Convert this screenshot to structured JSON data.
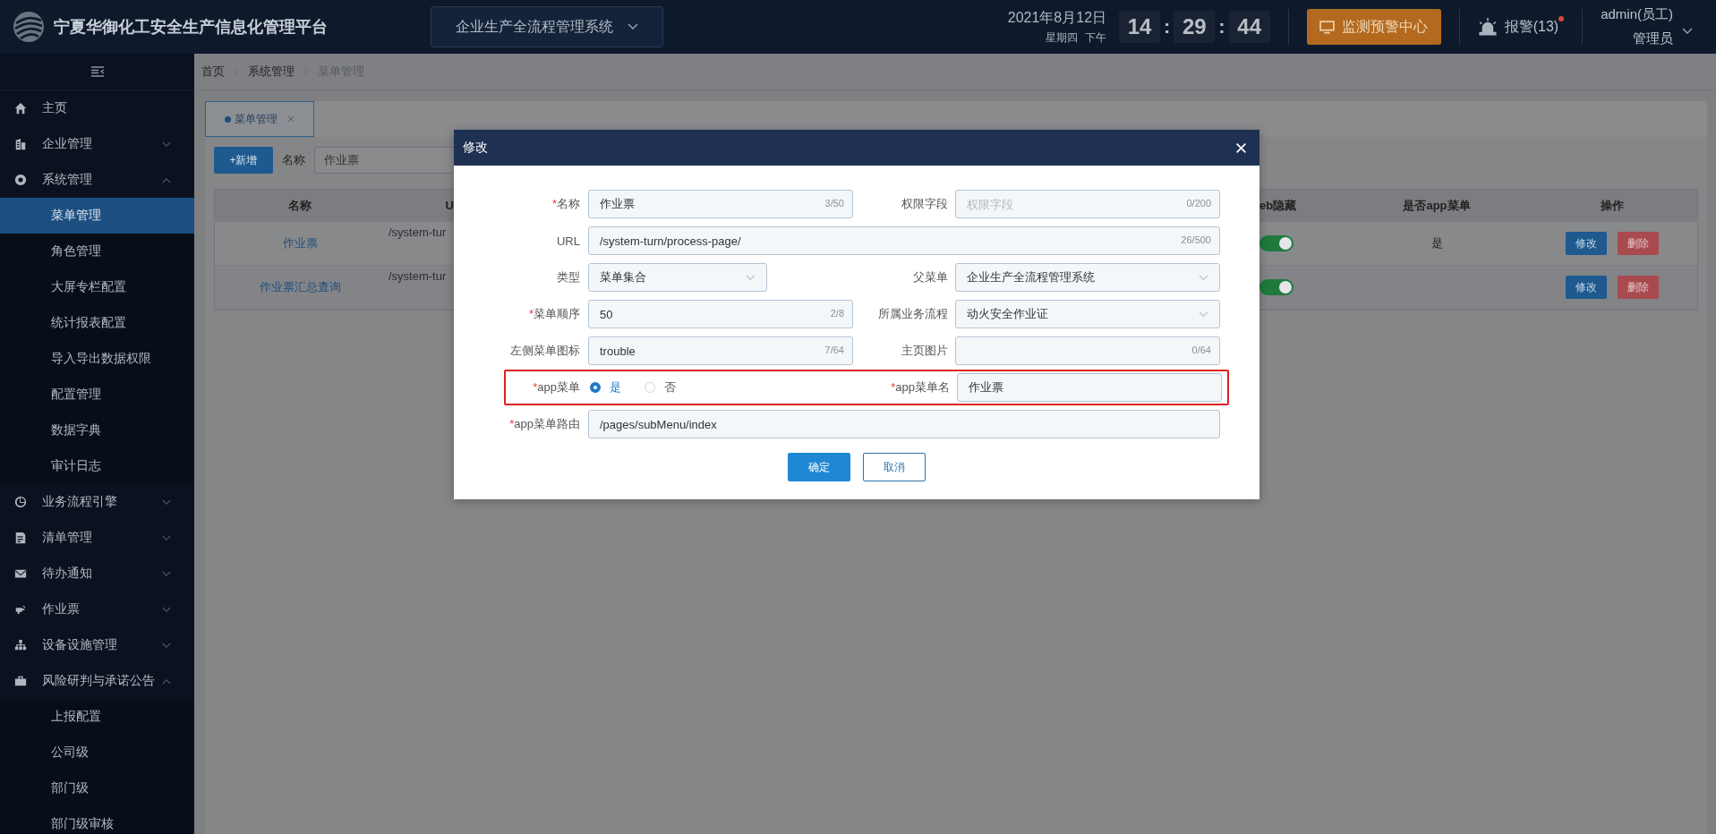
{
  "header": {
    "title": "宁夏华御化工安全生产信息化管理平台",
    "system_select": "企业生产全流程管理系统",
    "date": "2021年8月12日",
    "weekday": "星期四",
    "period": "下午",
    "clock": [
      "14",
      "29",
      "44"
    ],
    "clock_separator": ":",
    "monitor_button": "监测预警中心",
    "alarm": "报警(13)",
    "alarm_unread": true,
    "user": "admin(员工)",
    "role": "管理员"
  },
  "sidebar": {
    "items": [
      {
        "label": "主页",
        "kind": "link",
        "selected": false
      },
      {
        "label": "企业管理",
        "kind": "group",
        "selected": false,
        "expanded": false
      },
      {
        "label": "系统管理",
        "kind": "group",
        "selected": false,
        "expanded": true,
        "children": [
          {
            "label": "菜单管理",
            "selected": true
          },
          {
            "label": "角色管理",
            "selected": false
          },
          {
            "label": "大屏专栏配置",
            "selected": false
          },
          {
            "label": "统计报表配置",
            "selected": false
          },
          {
            "label": "导入导出数据权限",
            "selected": false
          },
          {
            "label": "配置管理",
            "selected": false
          },
          {
            "label": "数据字典",
            "selected": false
          },
          {
            "label": "审计日志",
            "selected": false
          }
        ]
      },
      {
        "label": "业务流程引擎",
        "kind": "group",
        "selected": false,
        "expanded": false
      },
      {
        "label": "清单管理",
        "kind": "group",
        "selected": false,
        "expanded": false
      },
      {
        "label": "待办通知",
        "kind": "group",
        "selected": false,
        "expanded": false
      },
      {
        "label": "作业票",
        "kind": "group",
        "selected": false,
        "expanded": false
      },
      {
        "label": "设备设施管理",
        "kind": "group",
        "selected": false,
        "expanded": false
      },
      {
        "label": "风险研判与承诺公告",
        "kind": "group",
        "selected": false,
        "expanded": true,
        "children": [
          {
            "label": "上报配置",
            "selected": false
          },
          {
            "label": "公司级",
            "selected": false
          },
          {
            "label": "部门级",
            "selected": false
          },
          {
            "label": "部门级审核",
            "selected": false
          }
        ]
      }
    ]
  },
  "breadcrumb": [
    "首页",
    "系统管理",
    "菜单管理"
  ],
  "tabs": [
    {
      "label": "菜单管理",
      "selected": true
    }
  ],
  "toolbar": {
    "add_button": "+新增",
    "name_label": "名称",
    "name_value": "作业票"
  },
  "table": {
    "columns": [
      "名称",
      "U",
      "eb隐藏",
      "是否app菜单",
      "操作"
    ],
    "rows": [
      {
        "name": "作业票",
        "url": "/system-tur",
        "web_hidden": true,
        "app_menu": "是",
        "actions": [
          "修改",
          "删除"
        ]
      },
      {
        "name": "作业票汇总查询",
        "url": "/system-tur",
        "web_hidden": true,
        "actions": [
          "修改",
          "删除"
        ]
      }
    ]
  },
  "dialog": {
    "title": "修改",
    "rows": [
      {
        "highlighted": false,
        "fields": [
          {
            "kind": "input",
            "label": "名称",
            "required_mark": "*",
            "value": "作业票",
            "counter": "3/50"
          },
          {
            "kind": "input",
            "label": "权限字段",
            "placeholder": "权限字段",
            "counter": "0/200"
          }
        ]
      },
      {
        "highlighted": false,
        "fields": [
          {
            "kind": "input",
            "label": "URL",
            "value": "/system-turn/process-page/",
            "counter": "26/500"
          }
        ]
      },
      {
        "highlighted": false,
        "fields": [
          {
            "kind": "select",
            "label": "类型",
            "value": "菜单集合"
          },
          {
            "kind": "select",
            "label": "父菜单",
            "value": "企业生产全流程管理系统"
          }
        ]
      },
      {
        "highlighted": false,
        "fields": [
          {
            "kind": "input",
            "label": "菜单顺序",
            "required_mark": "*",
            "value": "50",
            "counter": "2/8"
          },
          {
            "kind": "select",
            "label": "所属业务流程",
            "value": "动火安全作业证"
          }
        ]
      },
      {
        "highlighted": false,
        "fields": [
          {
            "kind": "input",
            "label": "左侧菜单图标",
            "value": "trouble",
            "counter": "7/64"
          },
          {
            "kind": "input",
            "label": "主页图片",
            "counter": "0/64"
          }
        ]
      },
      {
        "highlighted": true,
        "fields": [
          {
            "kind": "radio",
            "label": "app菜单",
            "required_mark": "*",
            "options": [
              {
                "label": "是",
                "selected": true
              },
              {
                "label": "否",
                "selected": false
              }
            ]
          },
          {
            "kind": "input",
            "label": "app菜单名",
            "required_mark": "*",
            "value": "作业票"
          }
        ]
      },
      {
        "highlighted": false,
        "fields": [
          {
            "kind": "input",
            "label": "app菜单路由",
            "required_mark": "*",
            "value": "/pages/subMenu/index"
          }
        ]
      }
    ],
    "buttons": [
      {
        "label": "确定",
        "kind": "primary"
      },
      {
        "label": "取消",
        "kind": "default"
      }
    ]
  }
}
